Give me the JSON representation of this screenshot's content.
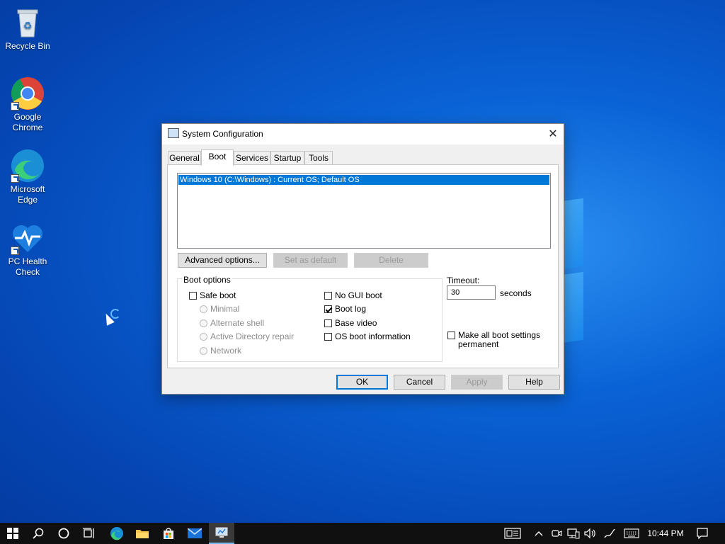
{
  "desktop": {
    "icons": [
      {
        "label": "Recycle Bin"
      },
      {
        "label": "Google Chrome"
      },
      {
        "label": "Microsoft Edge"
      },
      {
        "label": "PC Health Check"
      }
    ]
  },
  "dialog": {
    "title": "System Configuration",
    "close_glyph": "✕",
    "tabs": [
      "General",
      "Boot",
      "Services",
      "Startup",
      "Tools"
    ],
    "active_tab": "Boot",
    "os_entries": [
      "Windows 10 (C:\\Windows) : Current OS; Default OS"
    ],
    "buttons": {
      "advanced": "Advanced options...",
      "set_default": "Set as default",
      "delete": "Delete"
    },
    "boot_options": {
      "label": "Boot options",
      "safe_boot": {
        "label": "Safe boot",
        "checked": false
      },
      "radios": [
        "Minimal",
        "Alternate shell",
        "Active Directory repair",
        "Network"
      ],
      "no_gui_boot": {
        "label": "No GUI boot",
        "checked": false
      },
      "boot_log": {
        "label": "Boot log",
        "checked": true
      },
      "base_video": {
        "label": "Base video",
        "checked": false
      },
      "os_boot_info": {
        "label": "OS boot information",
        "checked": false
      }
    },
    "timeout": {
      "label": "Timeout:",
      "value": "30",
      "unit": "seconds"
    },
    "make_permanent": {
      "label_line1": "Make all boot settings",
      "label_line2": "permanent",
      "checked": false
    },
    "footer": {
      "ok": "OK",
      "cancel": "Cancel",
      "apply": "Apply",
      "help": "Help"
    }
  },
  "taskbar": {
    "clock": "10:44 PM"
  },
  "colors": {
    "selection": "#0078d7",
    "taskbar": "#101010"
  }
}
